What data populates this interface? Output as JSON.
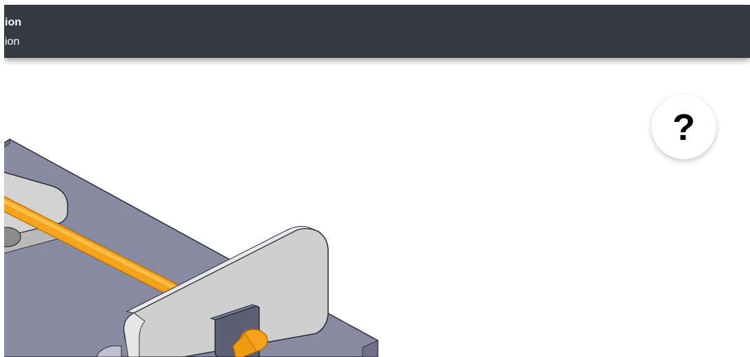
{
  "header": {
    "title": "ion",
    "subtitle": "ion"
  },
  "help_button": {
    "label": "?",
    "icon": "question-mark-icon"
  },
  "viewport": {
    "model": "3d-cad-assembly",
    "colors": {
      "base_plate": "#878aa0",
      "bracket": "#d0d0d0",
      "rod": "#f5a31a",
      "pin_housing": "#5a5d70",
      "header_bg": "#353a42"
    }
  }
}
